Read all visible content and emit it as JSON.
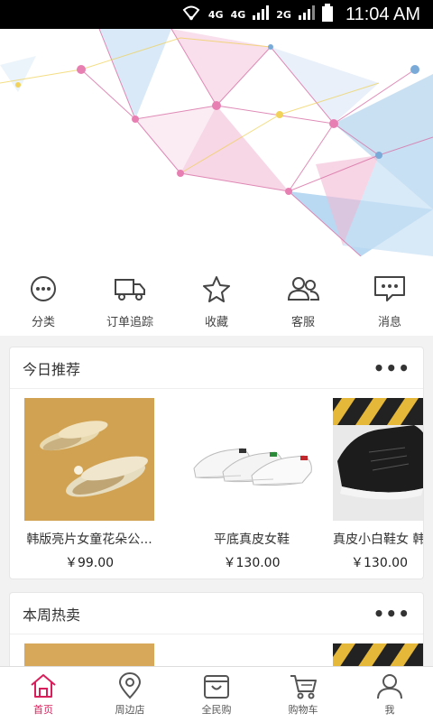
{
  "status_bar": {
    "network1": "4G",
    "network2": "4G",
    "network3": "2G",
    "time": "11:04 AM"
  },
  "colors": {
    "accent": "#d81e5b",
    "banner_pink": "#e8a0c0",
    "banner_blue": "#9cc4e4"
  },
  "quick_nav": [
    {
      "label": "分类",
      "icon": "more-circle-icon"
    },
    {
      "label": "订单追踪",
      "icon": "truck-icon"
    },
    {
      "label": "收藏",
      "icon": "star-icon"
    },
    {
      "label": "客服",
      "icon": "users-icon"
    },
    {
      "label": "消息",
      "icon": "message-icon"
    }
  ],
  "today": {
    "title": "今日推荐",
    "more": "•••",
    "products": [
      {
        "name": "韩版亮片女童花朵公...",
        "price": "￥99.00"
      },
      {
        "name": "平底真皮女鞋",
        "price": "￥130.00"
      },
      {
        "name": "真皮小白鞋女 韩",
        "price": "￥130.00"
      }
    ]
  },
  "weekly": {
    "title": "本周热卖",
    "more": "•••"
  },
  "bottom_nav": [
    {
      "label": "首页",
      "icon": "home-icon",
      "active": true
    },
    {
      "label": "周边店",
      "icon": "location-pin-icon"
    },
    {
      "label": "全民购",
      "icon": "bag-icon"
    },
    {
      "label": "购物车",
      "icon": "cart-icon"
    },
    {
      "label": "我",
      "icon": "user-icon"
    }
  ]
}
